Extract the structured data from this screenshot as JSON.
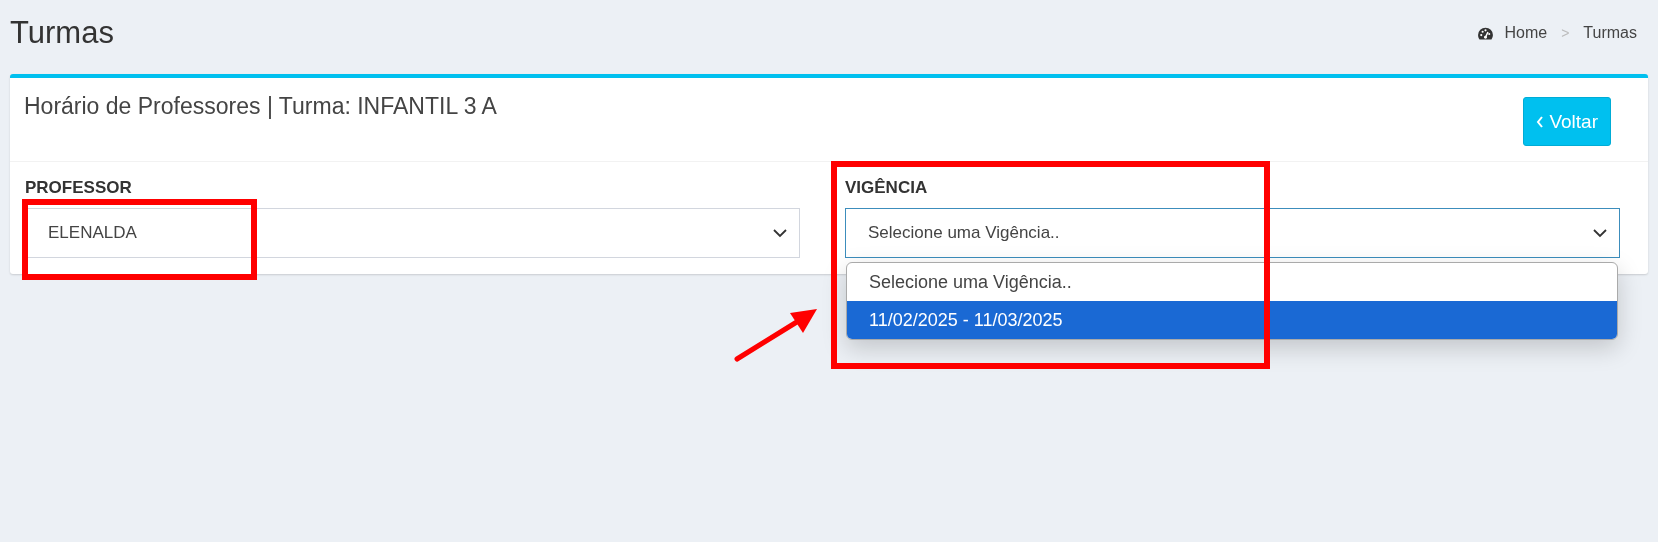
{
  "page": {
    "title": "Turmas"
  },
  "breadcrumb": {
    "separator": ">",
    "items": [
      {
        "label": "Home"
      },
      {
        "label": "Turmas"
      }
    ]
  },
  "card": {
    "title": "Horário de Professores | Turma: INFANTIL 3 A",
    "back_button": "Voltar"
  },
  "fields": [
    {
      "label": "PROFESSOR",
      "value": "ELENALDA",
      "focused": false
    },
    {
      "label": "VIGÊNCIA",
      "value": "Selecione uma Vigência..",
      "focused": true,
      "options": [
        {
          "label": "Selecione uma Vigência..",
          "highlighted": false
        },
        {
          "label": "11/02/2025 - 11/03/2025",
          "highlighted": true
        }
      ]
    }
  ]
}
